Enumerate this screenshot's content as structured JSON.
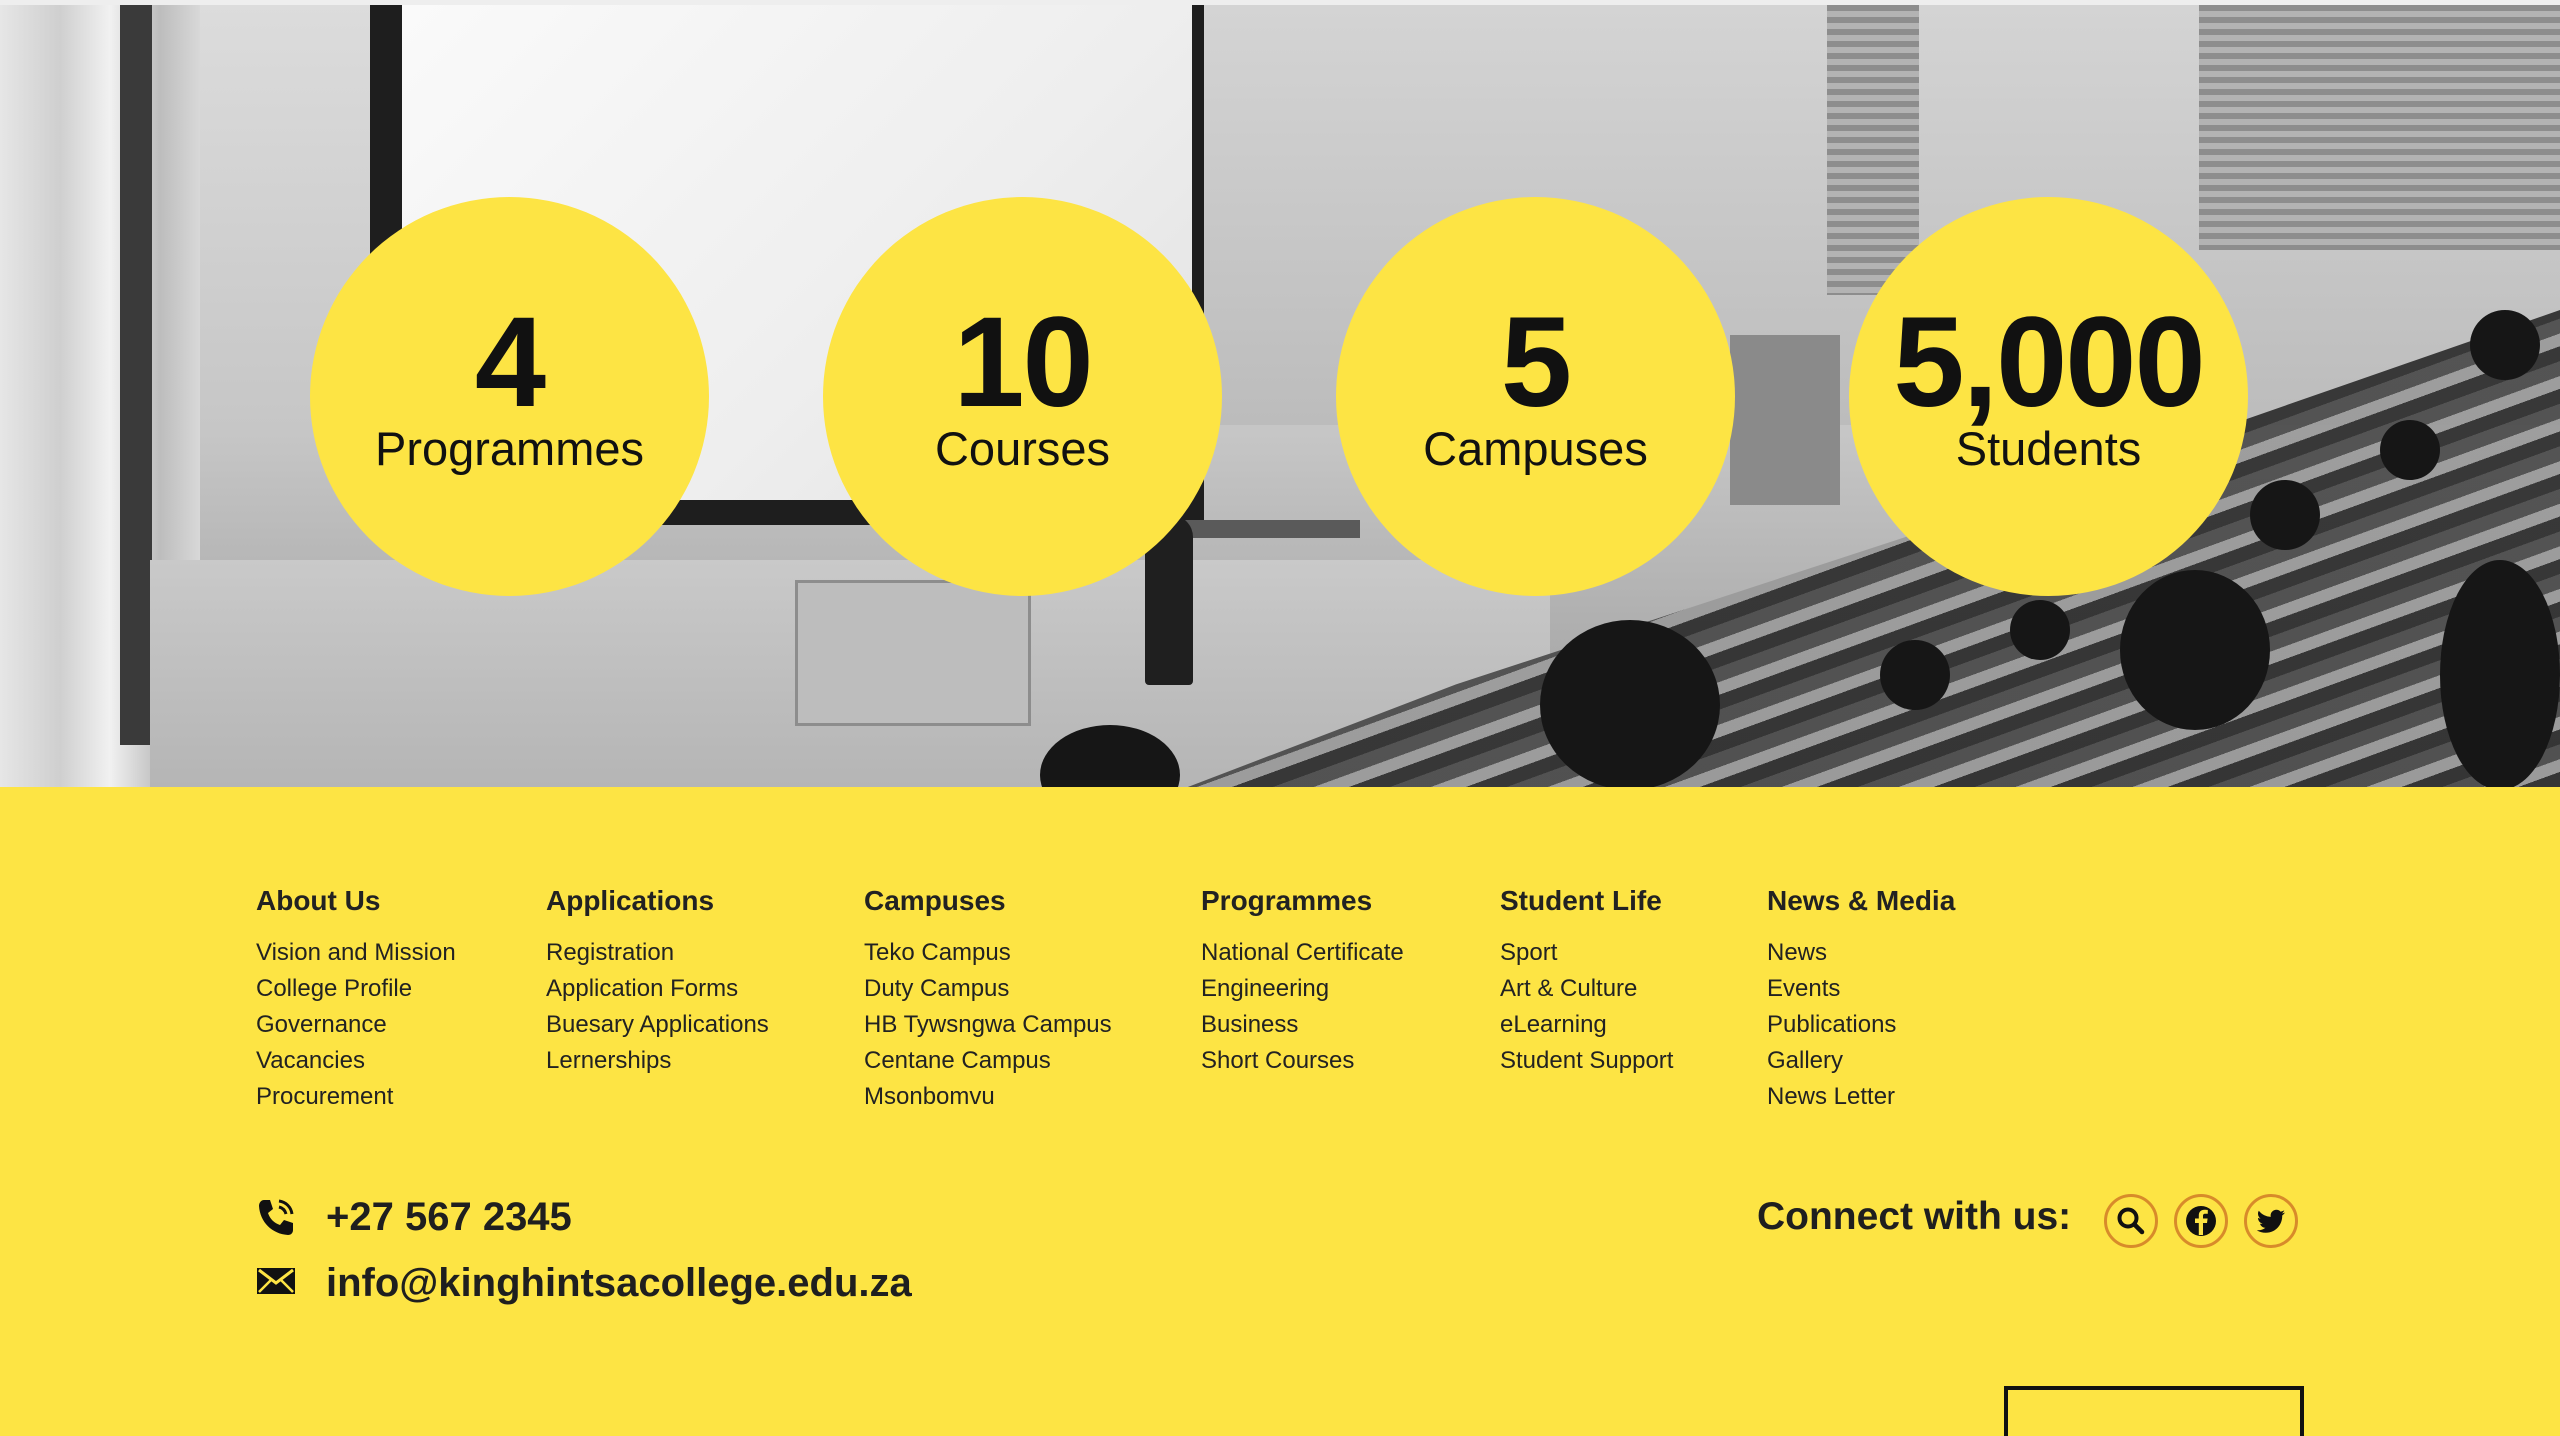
{
  "stats": [
    {
      "value": "4",
      "label": "Programmes"
    },
    {
      "value": "10",
      "label": "Courses"
    },
    {
      "value": "5",
      "label": "Campuses"
    },
    {
      "value": "5,000",
      "label": "Students"
    }
  ],
  "footer": {
    "columns": [
      {
        "heading": "About Us",
        "links": [
          "Vision and Mission",
          "College Profile",
          "Governance",
          "Vacancies",
          "Procurement"
        ]
      },
      {
        "heading": "Applications",
        "links": [
          "Registration",
          "Application Forms",
          "Buesary Applications",
          "Lernerships"
        ]
      },
      {
        "heading": "Campuses",
        "links": [
          "Teko Campus",
          "Duty Campus",
          "HB Tywsngwa Campus",
          "Centane Campus",
          "Msonbomvu"
        ]
      },
      {
        "heading": "Programmes",
        "links": [
          "National Certificate",
          "Engineering",
          "Business",
          "Short Courses"
        ]
      },
      {
        "heading": "Student Life",
        "links": [
          "Sport",
          "Art & Culture",
          "eLearning",
          "Student Support"
        ]
      },
      {
        "heading": "News & Media",
        "links": [
          "News",
          "Events",
          "Publications",
          "Gallery",
          "News Letter"
        ]
      }
    ],
    "phone": "+27 567 2345",
    "email": "info@kinghintsacollege.edu.za",
    "connect_label": "Connect with us:",
    "social_icons": [
      "search-icon",
      "facebook-icon",
      "twitter-icon"
    ]
  },
  "colors": {
    "accent": "#fde444",
    "text": "#1a1a1a",
    "social_ring": "#d88b2a"
  }
}
